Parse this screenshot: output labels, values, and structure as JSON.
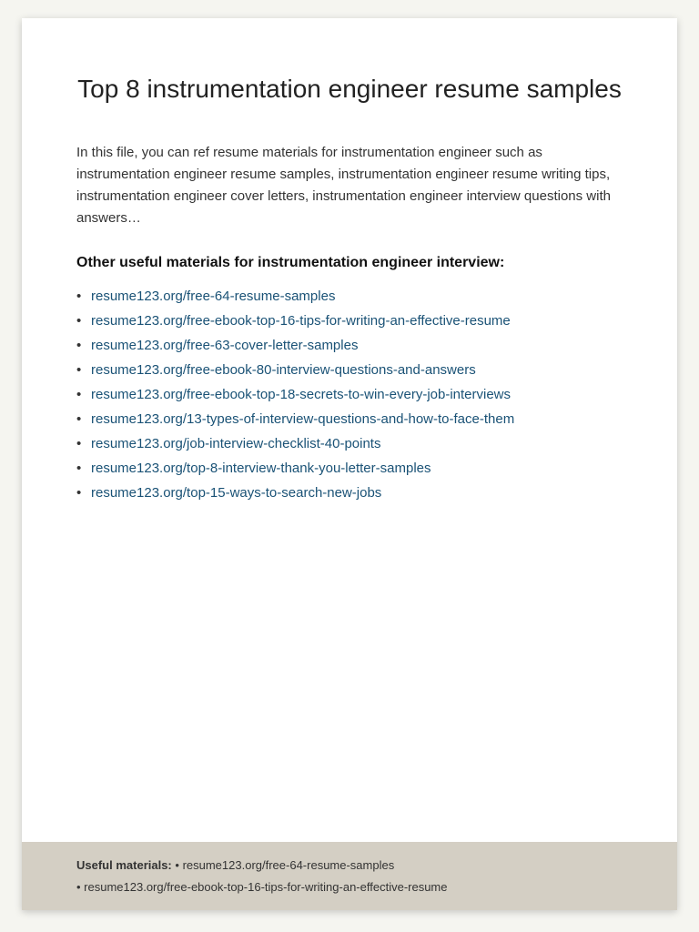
{
  "page": {
    "title": "Top 8 instrumentation engineer resume samples",
    "intro": "In this file, you can ref resume materials for instrumentation engineer such as  instrumentation engineer resume samples, instrumentation engineer resume writing tips, instrumentation engineer cover letters, instrumentation engineer interview questions with answers…",
    "section_heading": "Other useful materials for instrumentation engineer interview:",
    "bullet_items": [
      "resume123.org/free-64-resume-samples",
      "resume123.org/free-ebook-top-16-tips-for-writing-an-effective-resume",
      "resume123.org/free-63-cover-letter-samples",
      "resume123.org/free-ebook-80-interview-questions-and-answers",
      "resume123.org/free-ebook-top-18-secrets-to-win-every-job-interviews",
      "resume123.org/13-types-of-interview-questions-and-how-to-face-them",
      "resume123.org/job-interview-checklist-40-points",
      "resume123.org/top-8-interview-thank-you-letter-samples",
      "resume123.org/top-15-ways-to-search-new-jobs"
    ],
    "footer": {
      "label": "Useful materials:",
      "items": [
        "resume123.org/free-64-resume-samples",
        "resume123.org/free-ebook-top-16-tips-for-writing-an-effective-resume"
      ]
    }
  }
}
